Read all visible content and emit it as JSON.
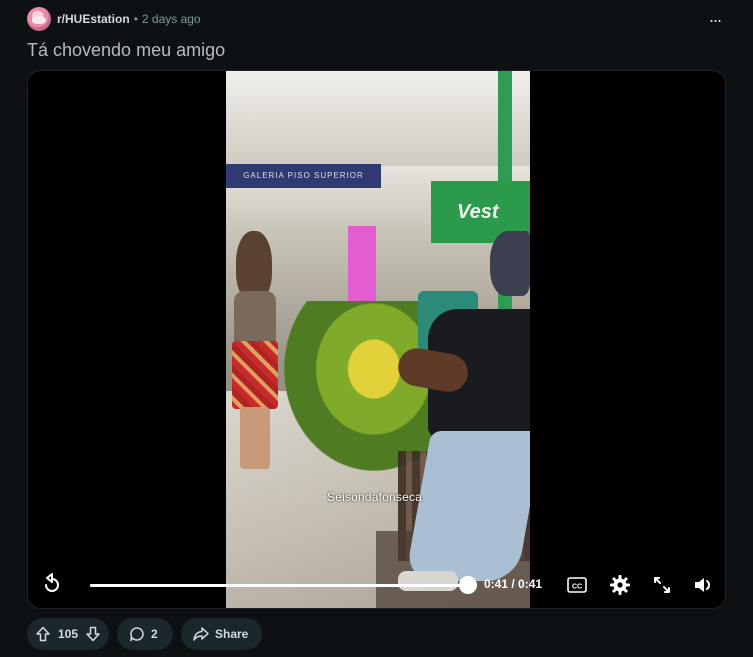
{
  "post": {
    "subreddit": "r/HUEstation",
    "separator": "•",
    "time": "2 days ago",
    "more_label": "...",
    "title": "Tá chovendo meu amigo"
  },
  "video": {
    "watermark": "Seisondafonseca",
    "time_display": "0:41 / 0:41",
    "progress_fraction": 1.0,
    "frame_text": {
      "sign": "GALERIA PISO SUPERIOR",
      "storefront": "Vest"
    },
    "controls": {
      "replay_icon": "replay-icon",
      "captions_label": "CC",
      "settings_icon": "gear-icon",
      "fullscreen_icon": "fullscreen-icon",
      "volume_icon": "volume-icon"
    }
  },
  "actions": {
    "votes": "105",
    "comments": "2",
    "share": "Share"
  },
  "colors": {
    "background": "#0e1113",
    "pill": "#1a282d",
    "text": "#d7dadc",
    "muted": "#82959b"
  }
}
